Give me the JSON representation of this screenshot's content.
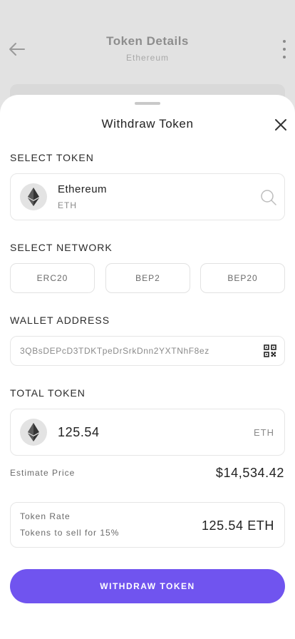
{
  "background_page": {
    "title": "Token Details",
    "subtitle": "Ethereum"
  },
  "sheet": {
    "title": "Withdraw Token",
    "select_token": {
      "label": "SELECT TOKEN",
      "name": "Ethereum",
      "symbol": "ETH"
    },
    "select_network": {
      "label": "SELECT NETWORK",
      "options": [
        "ERC20",
        "BEP2",
        "BEP20"
      ]
    },
    "wallet_address": {
      "label": "WALLET ADDRESS",
      "value": "3QBsDEPcD3TDKTpeDrSrkDnn2YXTNhF8ez"
    },
    "total_token": {
      "label": "TOTAL TOKEN",
      "amount": "125.54",
      "unit": "ETH"
    },
    "estimate": {
      "label": "Estimate Price",
      "value": "$14,534.42"
    },
    "rate": {
      "label": "Token Rate",
      "sub": "Tokens to sell for 15%",
      "value": "125.54 ETH"
    },
    "submit_label": "WITHDRAW TOKEN"
  },
  "colors": {
    "accent": "#7054ef",
    "overlay": "#e2e2e2"
  },
  "icons": [
    "back-arrow-icon",
    "more-vertical-icon",
    "close-icon",
    "ethereum-icon",
    "search-icon",
    "qr-code-icon"
  ]
}
